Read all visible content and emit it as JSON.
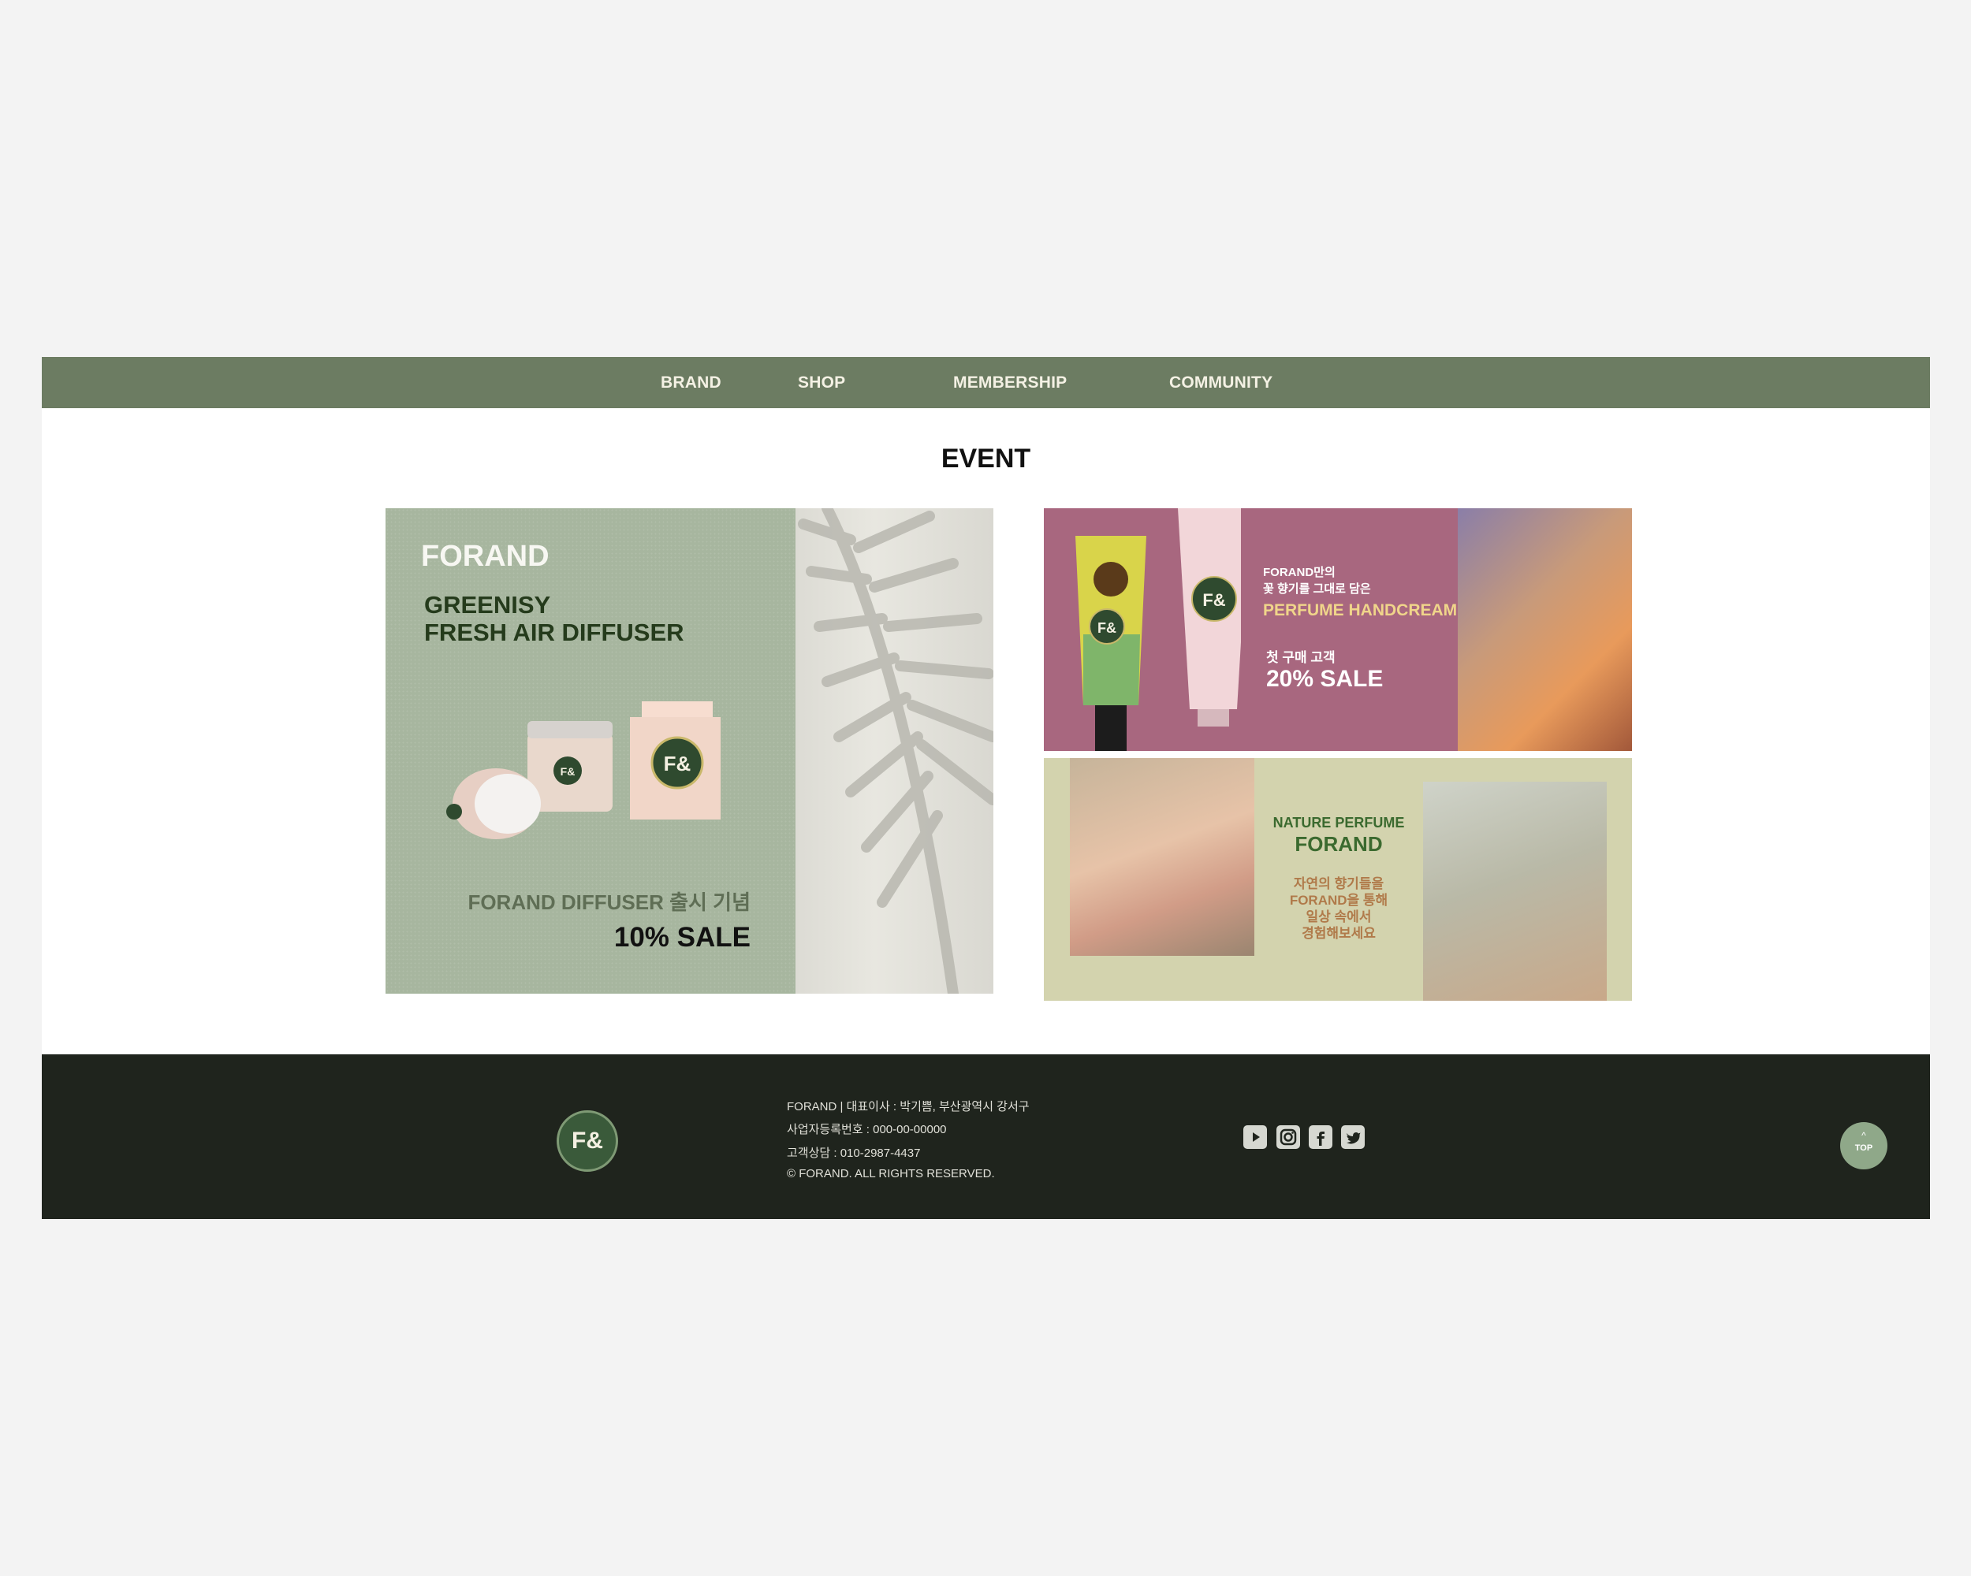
{
  "nav": {
    "items": [
      {
        "label": "BRAND"
      },
      {
        "label": "SHOP"
      },
      {
        "label": "MEMBERSHIP"
      },
      {
        "label": "COMMUNITY"
      }
    ]
  },
  "event": {
    "title": "EVENT",
    "banner1": {
      "brand": "FORAND",
      "headline_line1": "GREENISY",
      "headline_line2": "FRESH AIR DIFFUSER",
      "launch_text": "FORAND DIFFUSER 출시 기념",
      "sale_text": "10% SALE",
      "product_logo": "F&"
    },
    "banner2": {
      "line1": "FORAND만의",
      "line2": "꽃 향기를 그대로 담은",
      "product": "PERFUME HANDCREAM",
      "first_purchase": "첫 구매 고객",
      "sale_text": "20% SALE",
      "product_logo": "F&"
    },
    "banner3": {
      "subtitle": "NATURE PERFUME",
      "brand": "FORAND",
      "desc_line1": "자연의 향기들을",
      "desc_line2": "FORAND을 통해",
      "desc_line3": "일상 속에서",
      "desc_line4": "경험해보세요"
    }
  },
  "footer": {
    "logo": "F&",
    "info_line1": "FORAND | 대표이사 : 박기쁨, 부산광역시 강서구",
    "info_line2": "사업자등록번호 : 000-00-00000",
    "info_line3": "고객상담 : 010-2987-4437",
    "copyright": "© FORAND. ALL RIGHTS RESERVED.",
    "social": [
      "youtube-icon",
      "instagram-icon",
      "facebook-icon",
      "twitter-icon"
    ],
    "top_button": {
      "arrow": "^",
      "label": "TOP"
    }
  },
  "colors": {
    "nav_bg": "#6c7c62",
    "footer_bg": "#1f241d",
    "top_button": "#8fa889",
    "banner1_bg": "#a7b69f",
    "banner2_bg": "#a8677f",
    "banner3_bg": "#d3d3ae"
  }
}
